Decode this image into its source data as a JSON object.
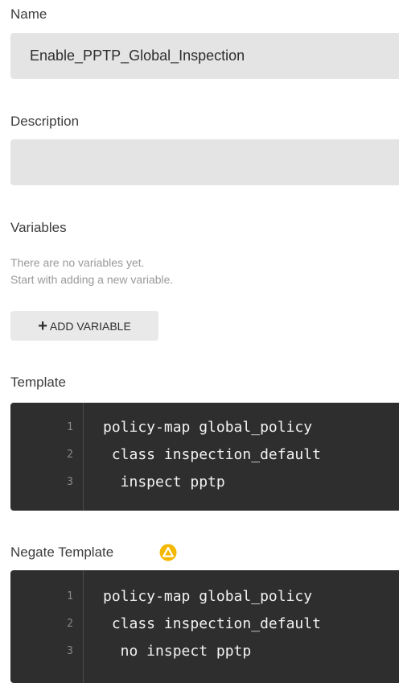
{
  "name": {
    "label": "Name",
    "value": "Enable_PPTP_Global_Inspection"
  },
  "description": {
    "label": "Description",
    "value": ""
  },
  "variables": {
    "label": "Variables",
    "empty_line1": "There are no variables yet.",
    "empty_line2": "Start with adding a new variable.",
    "add_button_label": "ADD VARIABLE"
  },
  "template": {
    "label": "Template",
    "lines": [
      {
        "num": "1",
        "code": "policy-map global_policy"
      },
      {
        "num": "2",
        "code": " class inspection_default"
      },
      {
        "num": "3",
        "code": "  inspect pptp"
      }
    ]
  },
  "negate_template": {
    "label": "Negate Template",
    "icon": "warning-icon",
    "icon_color": "#f5b800",
    "lines": [
      {
        "num": "1",
        "code": "policy-map global_policy"
      },
      {
        "num": "2",
        "code": " class inspection_default"
      },
      {
        "num": "3",
        "code": "  no inspect pptp"
      }
    ]
  }
}
